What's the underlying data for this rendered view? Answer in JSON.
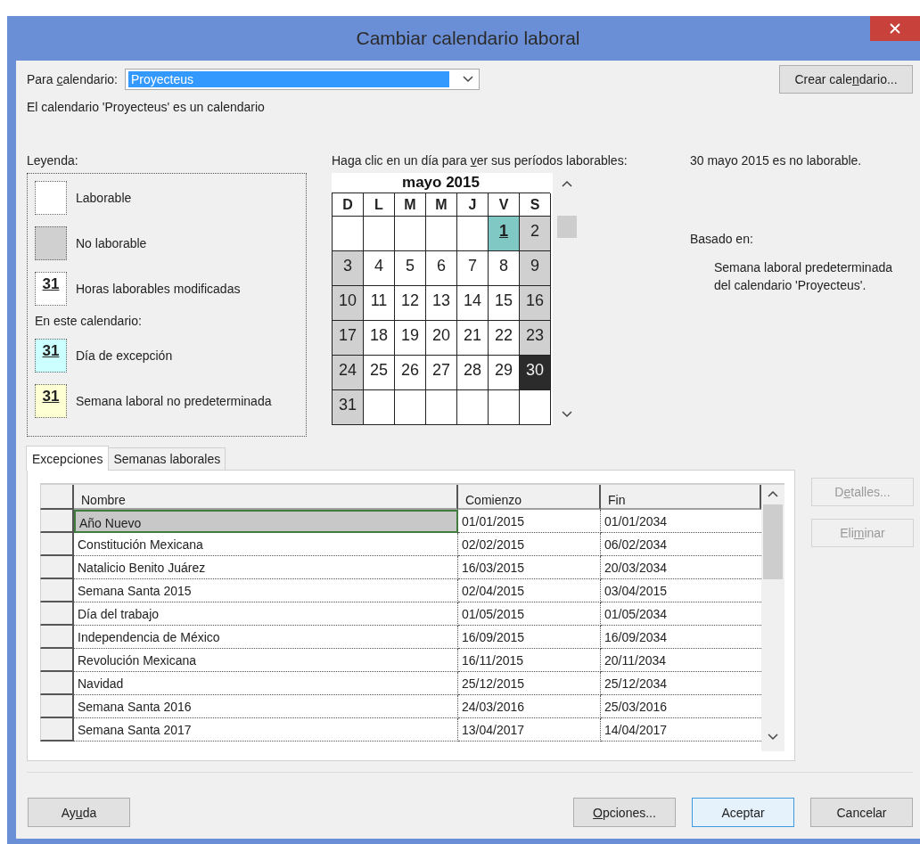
{
  "window": {
    "title": "Cambiar calendario laboral"
  },
  "calendar_select": {
    "label": {
      "before": "Para ",
      "key": "c",
      "after": "alendario:"
    },
    "value": "Proyecteus",
    "focused": true
  },
  "create_button": {
    "before": "Crear cale",
    "key": "n",
    "after": "dario..."
  },
  "description": "El calendario 'Proyecteus' es un calendario",
  "legend": {
    "title": "Leyenda:",
    "items": [
      {
        "kind": "working",
        "label": "Laborable"
      },
      {
        "kind": "nonworking",
        "label": "No laborable"
      },
      {
        "kind": "modified",
        "number": "31",
        "label": "Horas laborables modificadas"
      },
      {
        "kind": "heading",
        "label": "En este calendario:"
      },
      {
        "kind": "exception",
        "number": "31",
        "label": "Día de excepción"
      },
      {
        "kind": "nondefault",
        "number": "31",
        "label": "Semana laboral no predeterminada"
      }
    ]
  },
  "calendar": {
    "instruction": {
      "before": "Haga clic en un día para ",
      "key": "v",
      "after": "er sus períodos laborables:"
    },
    "month": "mayo 2015",
    "weekdays": [
      "D",
      "L",
      "M",
      "M",
      "J",
      "V",
      "S"
    ],
    "weeks": [
      [
        {
          "kind": "empty",
          "selected": false
        },
        {
          "kind": "empty",
          "selected": false
        },
        {
          "kind": "empty",
          "selected": false
        },
        {
          "kind": "empty",
          "selected": false
        },
        {
          "kind": "empty",
          "selected": false
        },
        {
          "day": "1",
          "kind": "exception",
          "selected": false
        },
        {
          "day": "2",
          "kind": "nonworking",
          "selected": false
        }
      ],
      [
        {
          "day": "3",
          "kind": "nonworking",
          "selected": false
        },
        {
          "day": "4",
          "kind": "working",
          "selected": false
        },
        {
          "day": "5",
          "kind": "working",
          "selected": false
        },
        {
          "day": "6",
          "kind": "working",
          "selected": false
        },
        {
          "day": "7",
          "kind": "working",
          "selected": false
        },
        {
          "day": "8",
          "kind": "working",
          "selected": false
        },
        {
          "day": "9",
          "kind": "nonworking",
          "selected": false
        }
      ],
      [
        {
          "day": "10",
          "kind": "nonworking",
          "selected": false
        },
        {
          "day": "11",
          "kind": "working",
          "selected": false
        },
        {
          "day": "12",
          "kind": "working",
          "selected": false
        },
        {
          "day": "13",
          "kind": "working",
          "selected": false
        },
        {
          "day": "14",
          "kind": "working",
          "selected": false
        },
        {
          "day": "15",
          "kind": "working",
          "selected": false
        },
        {
          "day": "16",
          "kind": "nonworking",
          "selected": false
        }
      ],
      [
        {
          "day": "17",
          "kind": "nonworking",
          "selected": false
        },
        {
          "day": "18",
          "kind": "working",
          "selected": false
        },
        {
          "day": "19",
          "kind": "working",
          "selected": false
        },
        {
          "day": "20",
          "kind": "working",
          "selected": false
        },
        {
          "day": "21",
          "kind": "working",
          "selected": false
        },
        {
          "day": "22",
          "kind": "working",
          "selected": false
        },
        {
          "day": "23",
          "kind": "nonworking",
          "selected": false
        }
      ],
      [
        {
          "day": "24",
          "kind": "nonworking",
          "selected": false
        },
        {
          "day": "25",
          "kind": "working",
          "selected": false
        },
        {
          "day": "26",
          "kind": "working",
          "selected": false
        },
        {
          "day": "27",
          "kind": "working",
          "selected": false
        },
        {
          "day": "28",
          "kind": "working",
          "selected": false
        },
        {
          "day": "29",
          "kind": "working",
          "selected": false
        },
        {
          "day": "30",
          "kind": "nonworking",
          "selected": true
        }
      ],
      [
        {
          "day": "31",
          "kind": "nonworking",
          "selected": false
        },
        {
          "kind": "empty",
          "selected": false
        },
        {
          "kind": "empty",
          "selected": false
        },
        {
          "kind": "empty",
          "selected": false
        },
        {
          "kind": "empty",
          "selected": false
        },
        {
          "kind": "empty",
          "selected": false
        },
        {
          "kind": "empty",
          "selected": false
        }
      ]
    ]
  },
  "day_info": {
    "status": "30 mayo 2015 es no laborable.",
    "based_on_label": "Basado en:",
    "based_on": "Semana laboral predeterminada del calendario 'Proyecteus'."
  },
  "tabs": [
    {
      "label": "Excepciones",
      "selected": true
    },
    {
      "label": "Semanas laborales",
      "selected": false
    }
  ],
  "table": {
    "columns": [
      "Nombre",
      "Comienzo",
      "Fin"
    ],
    "rows": [
      {
        "cells": [
          "Año Nuevo",
          "01/01/2015",
          "01/01/2034"
        ],
        "selected": true
      },
      {
        "cells": [
          "Constitución Mexicana",
          "02/02/2015",
          "06/02/2034"
        ],
        "selected": false
      },
      {
        "cells": [
          "Natalicio Benito Juárez",
          "16/03/2015",
          "20/03/2034"
        ],
        "selected": false
      },
      {
        "cells": [
          "Semana Santa 2015",
          "02/04/2015",
          "03/04/2015"
        ],
        "selected": false
      },
      {
        "cells": [
          "Día del trabajo",
          "01/05/2015",
          "01/05/2034"
        ],
        "selected": false
      },
      {
        "cells": [
          "Independencia de México",
          "16/09/2015",
          "16/09/2034"
        ],
        "selected": false
      },
      {
        "cells": [
          "Revolución Mexicana",
          "16/11/2015",
          "20/11/2034"
        ],
        "selected": false
      },
      {
        "cells": [
          "Navidad",
          "25/12/2015",
          "25/12/2034"
        ],
        "selected": false
      },
      {
        "cells": [
          "Semana Santa 2016",
          "24/03/2016",
          "25/03/2016"
        ],
        "selected": false
      },
      {
        "cells": [
          "Semana Santa 2017",
          "13/04/2017",
          "14/04/2017"
        ],
        "selected": false
      }
    ]
  },
  "side_buttons": [
    {
      "before": "D",
      "key": "e",
      "after": "talles...",
      "disabled": true
    },
    {
      "before": "Eli",
      "key": "m",
      "after": "inar",
      "disabled": true
    }
  ],
  "footer_buttons": [
    {
      "before": "Ay",
      "key": "u",
      "after": "da",
      "default": false
    },
    {
      "key": "O",
      "after": "pciones...",
      "default": false
    },
    {
      "after": "Aceptar",
      "default": true
    },
    {
      "after": "Cancelar",
      "default": false
    }
  ]
}
